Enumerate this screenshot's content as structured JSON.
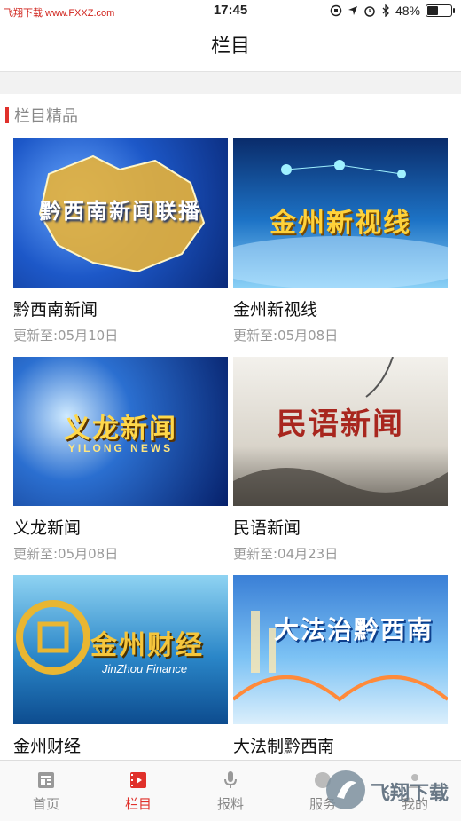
{
  "status_bar": {
    "carrier": "飞翔下载 www.FXXZ.com",
    "time": "17:45",
    "battery": "48%",
    "battery_level": 0.48
  },
  "navbar": {
    "title": "栏目"
  },
  "section": {
    "title": "栏目精品"
  },
  "cards": [
    {
      "name": "黔西南新闻",
      "updated": "更新至:05月10日",
      "thumb_title": "黔西南新闻联播"
    },
    {
      "name": "金州新视线",
      "updated": "更新至:05月08日",
      "thumb_title": "金州新视线"
    },
    {
      "name": "义龙新闻",
      "updated": "更新至:05月08日",
      "thumb_title": "义龙新闻",
      "thumb_sub": "YILONG NEWS"
    },
    {
      "name": "民语新闻",
      "updated": "更新至:04月23日",
      "thumb_title": "民语新闻"
    },
    {
      "name": "金州财经",
      "updated": "",
      "thumb_title": "金州财经",
      "thumb_sub": "JinZhou Finance"
    },
    {
      "name": "大法制黔西南",
      "updated": "",
      "thumb_title": "大法治黔西南"
    }
  ],
  "tabbar": {
    "tabs": [
      {
        "label": "首页",
        "icon": "news-icon"
      },
      {
        "label": "栏目",
        "icon": "video-icon",
        "active": true
      },
      {
        "label": "报料",
        "icon": "microphone-icon"
      },
      {
        "label": "服务",
        "icon": "service-icon"
      },
      {
        "label": "我的",
        "icon": "profile-icon"
      }
    ]
  },
  "watermark": {
    "text": "飞翔下载"
  }
}
